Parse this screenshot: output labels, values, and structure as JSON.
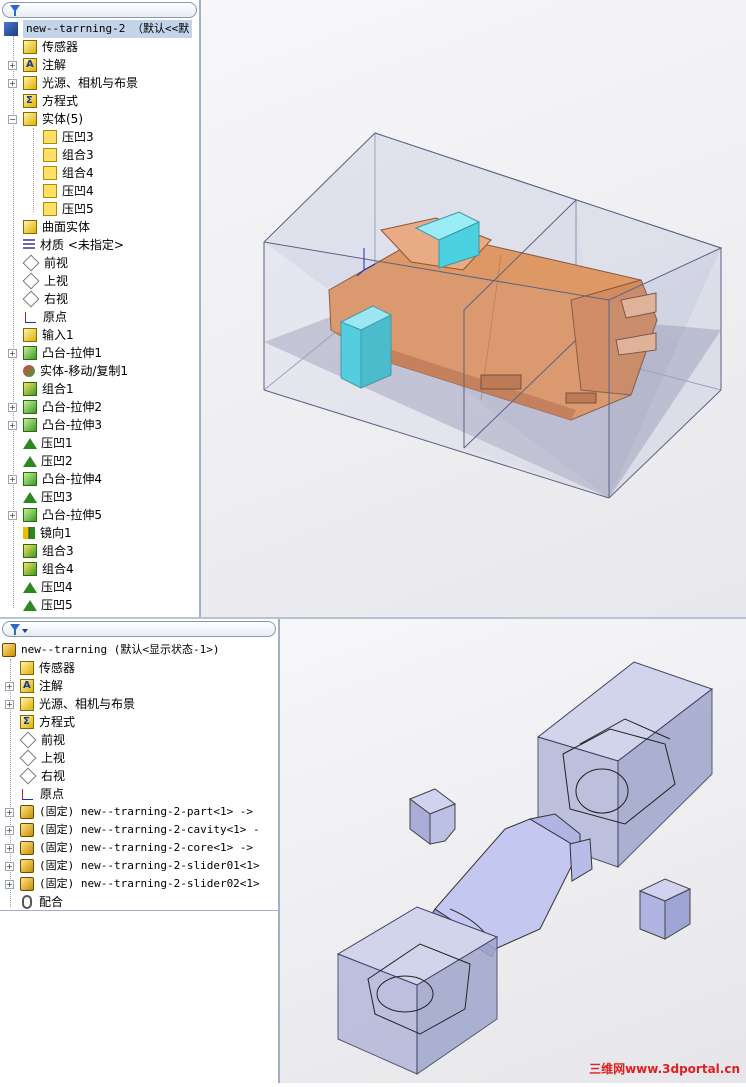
{
  "top_tree": {
    "root": "new--tarrning-2 （默认<<默",
    "items": [
      {
        "label": "传感器",
        "icon": "sensor-icon",
        "expand": false,
        "indent": 1
      },
      {
        "label": "注解",
        "icon": "annotation-icon",
        "expand": true,
        "indent": 1
      },
      {
        "label": "光源、相机与布景",
        "icon": "lights-icon",
        "expand": true,
        "indent": 1
      },
      {
        "label": "方程式",
        "icon": "equation-icon",
        "expand": false,
        "indent": 1
      },
      {
        "label": "实体(5)",
        "icon": "solid-bodies-icon",
        "expand": true,
        "expanded": true,
        "indent": 1
      },
      {
        "label": "压凹3",
        "icon": "body-icon",
        "expand": false,
        "indent": 2
      },
      {
        "label": "组合3",
        "icon": "body-icon",
        "expand": false,
        "indent": 2
      },
      {
        "label": "组合4",
        "icon": "body-icon",
        "expand": false,
        "indent": 2
      },
      {
        "label": "压凹4",
        "icon": "body-icon",
        "expand": false,
        "indent": 2
      },
      {
        "label": "压凹5",
        "icon": "body-icon",
        "expand": false,
        "indent": 2
      },
      {
        "label": "曲面实体",
        "icon": "surface-bodies-icon",
        "expand": false,
        "indent": 1
      },
      {
        "label": "材质 <未指定>",
        "icon": "material-icon",
        "expand": false,
        "indent": 1
      },
      {
        "label": "前视",
        "icon": "plane-icon",
        "expand": false,
        "indent": 1
      },
      {
        "label": "上视",
        "icon": "plane-icon",
        "expand": false,
        "indent": 1
      },
      {
        "label": "右视",
        "icon": "plane-icon",
        "expand": false,
        "indent": 1
      },
      {
        "label": "原点",
        "icon": "origin-icon",
        "expand": false,
        "indent": 1
      },
      {
        "label": "输入1",
        "icon": "import-icon",
        "expand": false,
        "indent": 1
      },
      {
        "label": "凸台-拉伸1",
        "icon": "extrude-icon",
        "expand": true,
        "indent": 1
      },
      {
        "label": "实体-移动/复制1",
        "icon": "move-copy-icon",
        "expand": false,
        "indent": 1
      },
      {
        "label": "组合1",
        "icon": "combine-icon",
        "expand": false,
        "indent": 1
      },
      {
        "label": "凸台-拉伸2",
        "icon": "extrude-icon",
        "expand": true,
        "indent": 1
      },
      {
        "label": "凸台-拉伸3",
        "icon": "extrude-icon",
        "expand": true,
        "indent": 1
      },
      {
        "label": "压凹1",
        "icon": "indent-icon",
        "expand": false,
        "indent": 1
      },
      {
        "label": "压凹2",
        "icon": "indent-icon",
        "expand": false,
        "indent": 1
      },
      {
        "label": "凸台-拉伸4",
        "icon": "extrude-icon",
        "expand": true,
        "indent": 1
      },
      {
        "label": "压凹3",
        "icon": "indent-icon",
        "expand": false,
        "indent": 1
      },
      {
        "label": "凸台-拉伸5",
        "icon": "extrude-icon",
        "expand": true,
        "indent": 1
      },
      {
        "label": "镜向1",
        "icon": "mirror-icon",
        "expand": false,
        "indent": 1
      },
      {
        "label": "组合3",
        "icon": "combine-icon",
        "expand": false,
        "indent": 1
      },
      {
        "label": "组合4",
        "icon": "combine-icon",
        "expand": false,
        "indent": 1
      },
      {
        "label": "压凹4",
        "icon": "indent-icon",
        "expand": false,
        "indent": 1
      },
      {
        "label": "压凹5",
        "icon": "indent-icon",
        "expand": false,
        "indent": 1
      }
    ]
  },
  "bottom_tree": {
    "root": "new--trarning  (默认<显示状态-1>)",
    "items": [
      {
        "label": "传感器",
        "icon": "sensor-icon",
        "expand": false
      },
      {
        "label": "注解",
        "icon": "annotation-icon",
        "expand": true
      },
      {
        "label": "光源、相机与布景",
        "icon": "lights-icon",
        "expand": true
      },
      {
        "label": "方程式",
        "icon": "equation-icon",
        "expand": false
      },
      {
        "label": "前视",
        "icon": "plane-icon",
        "expand": false
      },
      {
        "label": "上视",
        "icon": "plane-icon",
        "expand": false
      },
      {
        "label": "右视",
        "icon": "plane-icon",
        "expand": false
      },
      {
        "label": "原点",
        "icon": "origin-icon",
        "expand": false
      },
      {
        "label": "(固定) new--trarning-2-part<1> ->",
        "icon": "component-icon",
        "expand": true
      },
      {
        "label": "(固定) new--trarning-2-cavity<1> -",
        "icon": "component-icon",
        "expand": true
      },
      {
        "label": "(固定) new--trarning-2-core<1> ->",
        "icon": "component-icon",
        "expand": true
      },
      {
        "label": "(固定) new--trarning-2-slider01<1>",
        "icon": "component-icon",
        "expand": true
      },
      {
        "label": "(固定) new--trarning-2-slider02<1>",
        "icon": "component-icon",
        "expand": true
      },
      {
        "label": "配合",
        "icon": "mates-icon",
        "expand": false
      }
    ]
  },
  "watermark": "三维网www.3dportal.cn",
  "colors": {
    "part": "#e08a48",
    "slider": "#2ed0dc",
    "box": "#9aa2c8",
    "selection": "#c3d3e8"
  }
}
